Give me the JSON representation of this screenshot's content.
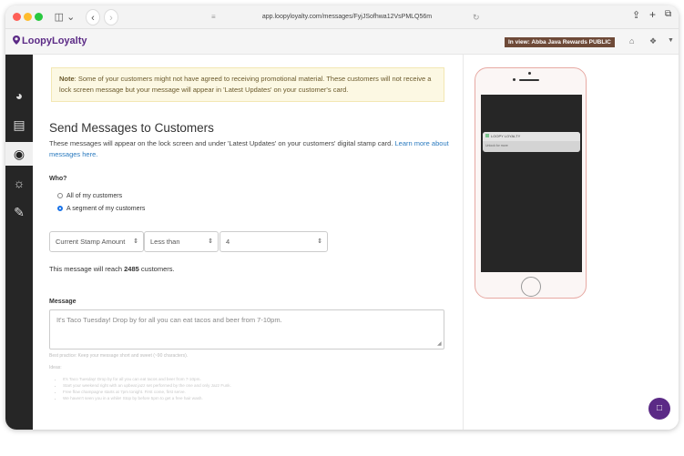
{
  "browser": {
    "url": "app.loopyloyalty.com/messages/FyjJSofhwa12VsPMLQ56m",
    "icons": [
      "sidebar-icon",
      "back-icon",
      "forward-icon",
      "reader-icon",
      "reload-icon",
      "share-icon",
      "new-tab-icon",
      "tabs-icon"
    ]
  },
  "header": {
    "logo": "LoopyLoyalty",
    "view_badge": "In view: Abba Java Rewards PUBLIC"
  },
  "nav": {
    "items": [
      "dashboard-icon",
      "reports-icon",
      "messages-icon",
      "customers-icon",
      "edit-icon"
    ]
  },
  "note": {
    "strong": "Note",
    "text": ": Some of your customers might not have agreed to receiving promotional material. These customers will not receive a lock screen message but your message will appear in 'Latest Updates' on your customer's card."
  },
  "page": {
    "title": "Send Messages to Customers",
    "description": "These messages will appear on the lock screen and under 'Latest Updates' on your customers' digital stamp card. ",
    "link": "Learn more about messages here."
  },
  "who": {
    "label": "Who?",
    "options": [
      "All of my customers",
      "A segment of my customers"
    ],
    "selected": "A segment of my customers"
  },
  "segment": {
    "field": "Current Stamp Amount",
    "operator": "Less than",
    "value": "4"
  },
  "reach": {
    "prefix": "This message will reach ",
    "count": "2485",
    "suffix": " customers."
  },
  "message": {
    "label": "Message",
    "placeholder": "It's Taco Tuesday! Drop by for all you can eat tacos and beer from 7-10pm.",
    "hint": "Best practice: Keep your message short and sweet (~90 characters).",
    "ideas_label": "Ideas:",
    "ideas": [
      "It's Taco Tuesday! Drop by for all you can eat tacos and beer from 7-10pm.",
      "Start your weekend right with an upbeat jazz set performed by the one and only Jazz Funk.",
      "Free flow champagne starts at 7pm tonight. First come, first serve.",
      "We haven't seen you in a while! Stop by before 5pm to get a free hair wash."
    ]
  },
  "preview": {
    "app_name": "LOOPY LOYALTY",
    "notification_text": "Unlock for more"
  },
  "colors": {
    "brand": "#5b2a86",
    "badge": "#6e4a38",
    "note_bg": "#fcf8e3",
    "link": "#2a7abf",
    "nav_bg": "#262626"
  }
}
